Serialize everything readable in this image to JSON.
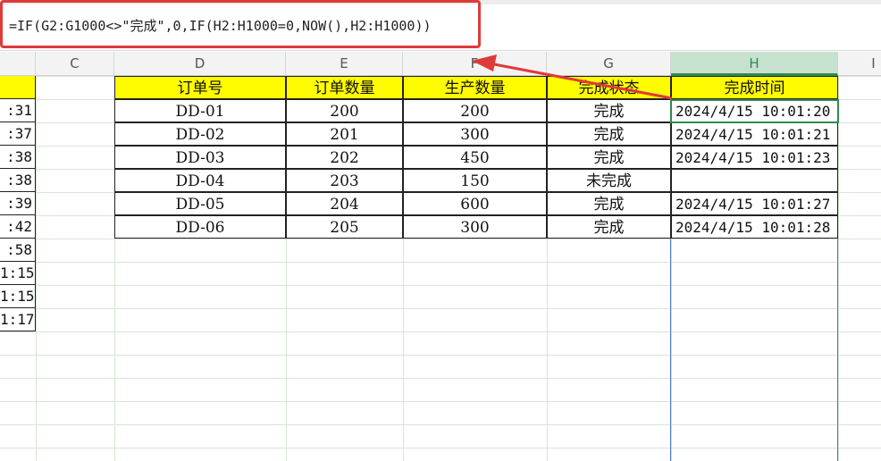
{
  "formula_bar": {
    "formula": "=IF(G2:G1000<>\"完成\",0,IF(H2:H1000=0,NOW(),H2:H1000))"
  },
  "column_headers": [
    "C",
    "D",
    "E",
    "F",
    "G",
    "H",
    "I"
  ],
  "table": {
    "headers": [
      "订单号",
      "订单数量",
      "生产数量",
      "完成状态",
      "完成时间"
    ],
    "rows": [
      [
        "DD-01",
        "200",
        "200",
        "完成",
        "2024/4/15 10:01:20"
      ],
      [
        "DD-02",
        "201",
        "300",
        "完成",
        "2024/4/15 10:01:21"
      ],
      [
        "DD-03",
        "202",
        "450",
        "完成",
        "2024/4/15 10:01:23"
      ],
      [
        "DD-04",
        "203",
        "150",
        "未完成",
        ""
      ],
      [
        "DD-05",
        "204",
        "600",
        "完成",
        "2024/4/15 10:01:27"
      ],
      [
        "DD-06",
        "205",
        "300",
        "完成",
        "2024/4/15 10:01:28"
      ]
    ]
  },
  "left_column_fragments": [
    ":31",
    ":37",
    ":38",
    ":38",
    ":39",
    ":42",
    ":58",
    "1:15",
    "1:15",
    "1:17"
  ],
  "colors": {
    "header_fill": "#fffb00",
    "annotation_red": "#e0393a",
    "selection_green": "#2f8a4f"
  }
}
